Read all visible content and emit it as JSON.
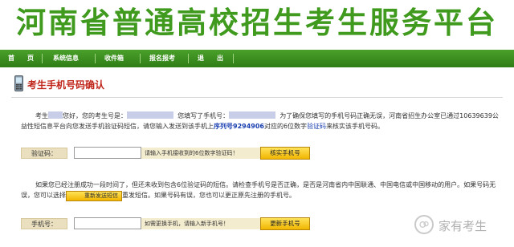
{
  "banner": {
    "title": "河南省普通高校招生考生服务平台"
  },
  "nav": {
    "items": [
      {
        "label": "首　　页"
      },
      {
        "label": "系统信息"
      },
      {
        "label": "收件箱"
      },
      {
        "label": "报名报考"
      },
      {
        "label": "退　　出"
      }
    ]
  },
  "page": {
    "title": "考生手机号码确认"
  },
  "intro": {
    "p1": "考生",
    "p2": "您好，您的考生号是：",
    "p3": "您填写了手机号：",
    "p4": "为了确保您填写的手机号码正确无误，河南省招生办公室已通过10639639公益性短信息平台向您发送手机验证码短信，请您输入发送到该手机上",
    "p5": "序列号9294906",
    "p6": "对应的6位数字",
    "p7": "验证码",
    "p8": "来核实该手机号码。"
  },
  "verify_form": {
    "label": "验证码：",
    "tip": "请输入手机接收到的6位数字验证码！",
    "button": "核实手机号"
  },
  "notice": {
    "q1": "如果您已经注册成功一段时间了，但还未收到包含6位验证码的短信。请检查手机号是否正确，是否是河南省内中国联通、中国电信或中国移动的用户。如果号码无误，您可以选择",
    "resend_button": "重新发送短信",
    "q2": "重发短信。如果号码有误，您也可以更正原先注册的手机号。"
  },
  "phone_form": {
    "label": "手机号：",
    "tip": "如需更换手机，请输入新手机号！",
    "button": "更新手机号"
  },
  "watermark": {
    "text": "家有考生"
  },
  "colors": {
    "brand_green": "#3f9a1e",
    "nav_green": "#2f7d16",
    "title_red": "#c0251a",
    "link_blue": "#1a3fb0",
    "button_yellow": "#f2b600"
  }
}
